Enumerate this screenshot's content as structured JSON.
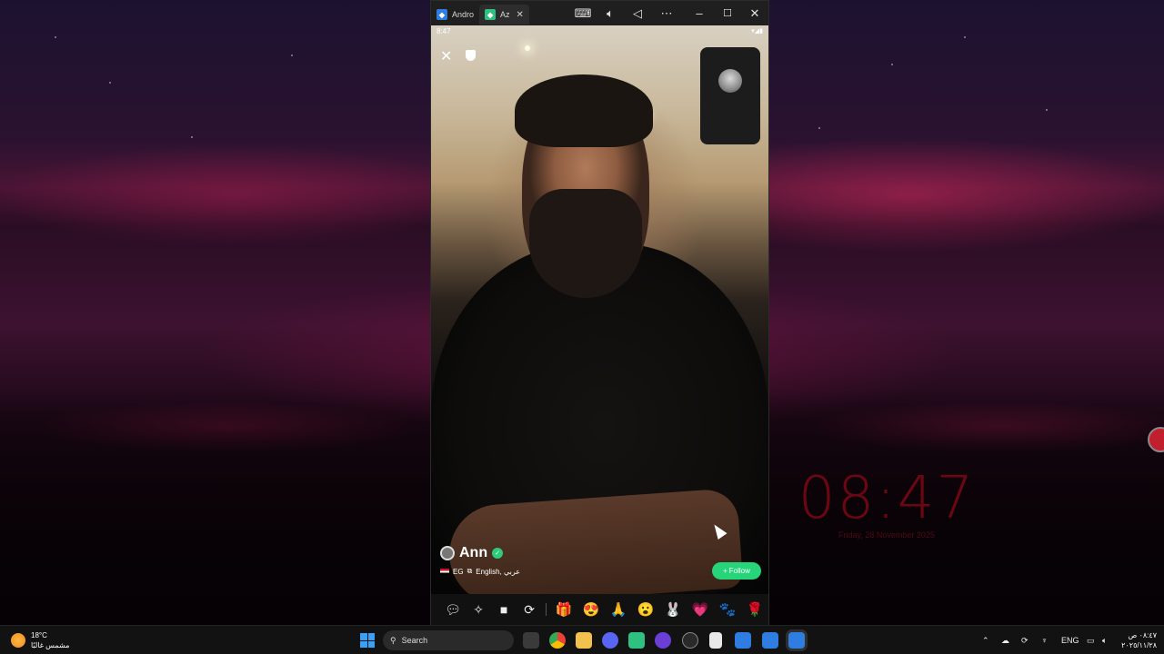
{
  "window": {
    "tabs": [
      {
        "label": "Andro",
        "icon": "emulator-icon"
      },
      {
        "label": "Az",
        "icon": "azar-app-icon"
      }
    ],
    "controls": [
      "keyboard-icon",
      "volume-icon",
      "back-icon",
      "more-icon",
      "minimize-icon",
      "maximize-icon",
      "close-icon"
    ]
  },
  "phone": {
    "status_time": "8:47",
    "status_icons": "▾◢▮",
    "remote_user": {
      "name": "Ann",
      "country": "EG",
      "languages": "English, عربي"
    },
    "follow_label": "Follow",
    "follow_color": "#26d47a",
    "bottom_buttons": [
      "chat-icon",
      "effects-icon",
      "camera-icon",
      "switch-camera-icon"
    ],
    "gifts": [
      "🎁",
      "😍",
      "🙏",
      "😮",
      "🐰",
      "💗",
      "🐾",
      "🌹"
    ]
  },
  "desktop": {
    "clock_time": "08:47",
    "clock_date": "Friday, 28 November 2025"
  },
  "taskbar": {
    "weather_temp": "18°C",
    "weather_desc": "مشمس غالبًا",
    "search_placeholder": "Search",
    "language": "ENG",
    "time": "٠٨:٤٧ ص",
    "date": "٢٠٢٥/١١/٢٨"
  }
}
